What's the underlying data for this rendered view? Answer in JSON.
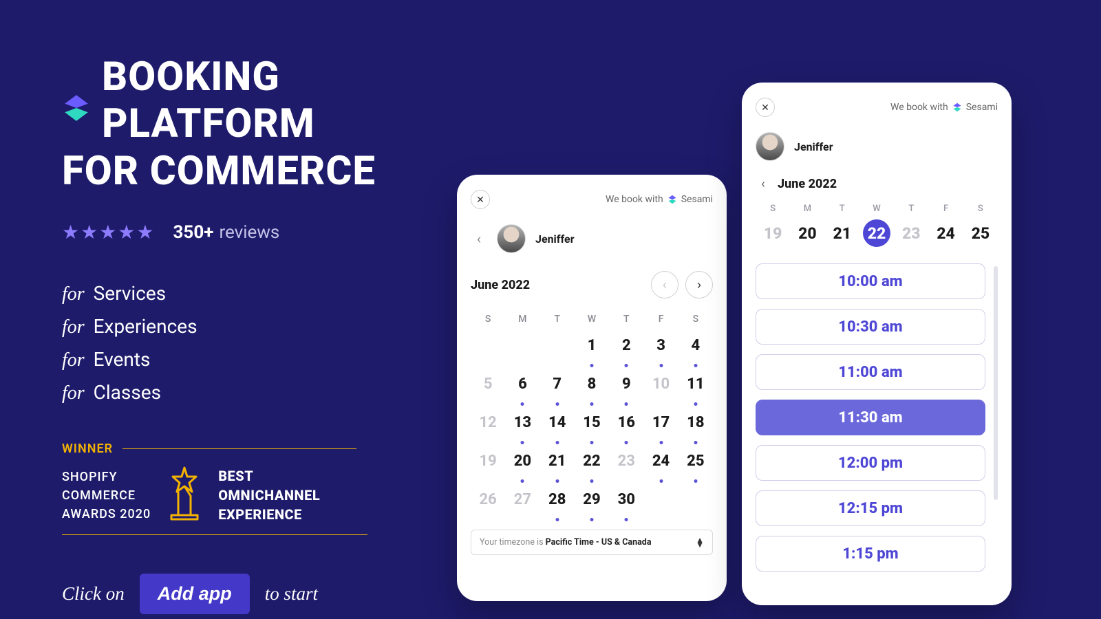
{
  "headline": {
    "line1": "BOOKING PLATFORM",
    "line2": "FOR COMMERCE"
  },
  "reviews": {
    "count": "350+",
    "label": "reviews",
    "stars": 5
  },
  "for_prefix": "for",
  "for_items": [
    "Services",
    "Experiences",
    "Events",
    "Classes"
  ],
  "award": {
    "winner": "WINNER",
    "left_l1": "SHOPIFY",
    "left_l2": "COMMERCE",
    "left_l3": "AWARDS 2020",
    "right_l1": "BEST",
    "right_l2": "OMNICHANNEL",
    "right_l3": "EXPERIENCE"
  },
  "cta": {
    "prefix": "Click on",
    "button": "Add app",
    "suffix": "to start"
  },
  "book_with_prefix": "We book with",
  "book_with_brand": "Sesami",
  "staff_name": "Jeniffer",
  "month_label": "June 2022",
  "dow": [
    "S",
    "M",
    "T",
    "W",
    "T",
    "F",
    "S"
  ],
  "calendar_days": [
    {
      "n": "",
      "dim": false,
      "avail": false
    },
    {
      "n": "",
      "dim": false,
      "avail": false
    },
    {
      "n": "",
      "dim": false,
      "avail": false
    },
    {
      "n": "1",
      "dim": false,
      "avail": true
    },
    {
      "n": "2",
      "dim": false,
      "avail": true
    },
    {
      "n": "3",
      "dim": false,
      "avail": true
    },
    {
      "n": "4",
      "dim": false,
      "avail": true
    },
    {
      "n": "5",
      "dim": true,
      "avail": false
    },
    {
      "n": "6",
      "dim": false,
      "avail": true
    },
    {
      "n": "7",
      "dim": false,
      "avail": true
    },
    {
      "n": "8",
      "dim": false,
      "avail": true
    },
    {
      "n": "9",
      "dim": false,
      "avail": true
    },
    {
      "n": "10",
      "dim": true,
      "avail": false
    },
    {
      "n": "11",
      "dim": false,
      "avail": true
    },
    {
      "n": "12",
      "dim": true,
      "avail": false
    },
    {
      "n": "13",
      "dim": false,
      "avail": true
    },
    {
      "n": "14",
      "dim": false,
      "avail": true
    },
    {
      "n": "15",
      "dim": false,
      "avail": true
    },
    {
      "n": "16",
      "dim": false,
      "avail": true
    },
    {
      "n": "17",
      "dim": false,
      "avail": true
    },
    {
      "n": "18",
      "dim": false,
      "avail": true
    },
    {
      "n": "19",
      "dim": true,
      "avail": false
    },
    {
      "n": "20",
      "dim": false,
      "avail": true
    },
    {
      "n": "21",
      "dim": false,
      "avail": true
    },
    {
      "n": "22",
      "dim": false,
      "avail": true
    },
    {
      "n": "23",
      "dim": true,
      "avail": false
    },
    {
      "n": "24",
      "dim": false,
      "avail": true
    },
    {
      "n": "25",
      "dim": false,
      "avail": true
    },
    {
      "n": "26",
      "dim": true,
      "avail": false
    },
    {
      "n": "27",
      "dim": true,
      "avail": false
    },
    {
      "n": "28",
      "dim": false,
      "avail": true
    },
    {
      "n": "29",
      "dim": false,
      "avail": true
    },
    {
      "n": "30",
      "dim": false,
      "avail": true
    },
    {
      "n": "",
      "dim": false,
      "avail": false
    },
    {
      "n": "",
      "dim": false,
      "avail": false
    }
  ],
  "timezone": {
    "prefix": "Your timezone is ",
    "value": "Pacific Time - US & Canada"
  },
  "week": {
    "days": [
      {
        "n": "19",
        "dim": true
      },
      {
        "n": "20",
        "dim": false
      },
      {
        "n": "21",
        "dim": false
      },
      {
        "n": "22",
        "dim": false,
        "sel": true
      },
      {
        "n": "23",
        "dim": true
      },
      {
        "n": "24",
        "dim": false
      },
      {
        "n": "25",
        "dim": false
      }
    ]
  },
  "slots": [
    {
      "t": "10:00 am",
      "sel": false
    },
    {
      "t": "10:30 am",
      "sel": false
    },
    {
      "t": "11:00 am",
      "sel": false
    },
    {
      "t": "11:30 am",
      "sel": true
    },
    {
      "t": "12:00 pm",
      "sel": false
    },
    {
      "t": "12:15 pm",
      "sel": false
    },
    {
      "t": "1:15 pm",
      "sel": false
    }
  ],
  "colors": {
    "bg": "#1e1b6b",
    "accent": "#4e47d6",
    "gold": "#f2b200",
    "star": "#8e7cff"
  }
}
